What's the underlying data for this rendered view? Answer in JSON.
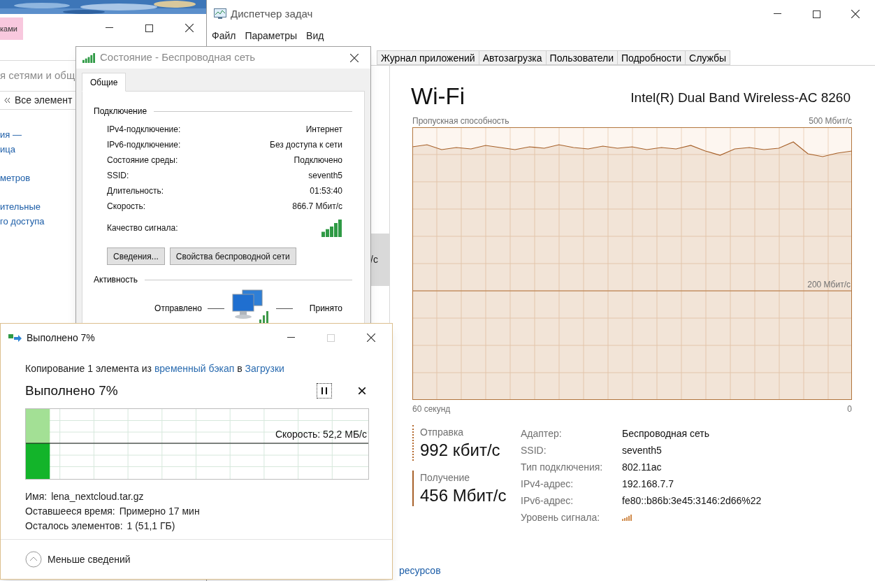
{
  "control_panel": {
    "tab_label": "ками",
    "address_fragment": "я сетями и общ",
    "breadcrumb": "Все элемент",
    "links": [
      {
        "lines": [
          "ия —",
          "ица"
        ]
      },
      {
        "lines": [
          "метров"
        ]
      },
      {
        "lines": [
          "ительные",
          "го доступа"
        ]
      }
    ]
  },
  "task_manager": {
    "title": "Диспетчер задач",
    "menu": [
      "Файл",
      "Параметры",
      "Вид"
    ],
    "tabs": [
      {
        "label": "Журнал приложений",
        "selected": false
      },
      {
        "label": "Автозагрузка",
        "selected": false
      },
      {
        "label": "Пользователи",
        "selected": false
      },
      {
        "label": "Подробности",
        "selected": false
      },
      {
        "label": "Службы",
        "selected": false
      }
    ],
    "sidebar_fragment": "/с",
    "device_title": "Wi-Fi",
    "adapter_name": "Intel(R) Dual Band Wireless-AC 8260",
    "graph": {
      "title": "Пропускная способность",
      "top_label": "500 Мбит/с",
      "mid_label": "200 Мбит/с",
      "left_label": "60 секунд",
      "right_label": "0"
    },
    "send": {
      "label": "Отправка",
      "value": "992 кбит/с"
    },
    "receive": {
      "label": "Получение",
      "value": "456 Мбит/с"
    },
    "details": [
      {
        "kind": "text",
        "label": "Адаптер:",
        "value": "Беспроводная сеть"
      },
      {
        "kind": "text",
        "label": "SSID:",
        "value": "seventh5"
      },
      {
        "kind": "text",
        "label": "Тип подключения:",
        "value": "802.11ac"
      },
      {
        "kind": "text",
        "label": "IPv4-адрес:",
        "value": "192.168.7.7"
      },
      {
        "kind": "text",
        "label": "IPv6-адрес:",
        "value": "fe80::b86b:3e45:3146:2d66%22"
      },
      {
        "kind": "signal",
        "label": "Уровень сигнала:"
      }
    ],
    "resource_link": "ресурсов"
  },
  "status_dialog": {
    "title": "Состояние - Беспроводная сеть",
    "tabs": [
      {
        "label": "Общие",
        "selected": true
      }
    ],
    "connection_header": "Подключение",
    "rows": [
      {
        "kind": "text",
        "label": "IPv4-подключение:",
        "value": "Интернет"
      },
      {
        "kind": "text",
        "label": "IPv6-подключение:",
        "value": "Без доступа к сети"
      },
      {
        "kind": "text",
        "label": "Состояние среды:",
        "value": "Подключено"
      },
      {
        "kind": "text",
        "label": "SSID:",
        "value": "seventh5"
      },
      {
        "kind": "text",
        "label": "Длительность:",
        "value": "01:53:40"
      },
      {
        "kind": "text",
        "label": "Скорость:",
        "value": "866.7 Мбит/с"
      },
      {
        "kind": "signal",
        "label": "Качество сигнала:"
      }
    ],
    "buttons": [
      "Сведения...",
      "Свойства беспроводной сети"
    ],
    "activity_header": "Активность",
    "sent": "Отправлено",
    "received": "Принято"
  },
  "copy_dialog": {
    "title": "Выполнено 7%",
    "window_buttons": [
      {
        "kind": "minimize",
        "disabled": false
      },
      {
        "kind": "maximize",
        "disabled": true
      },
      {
        "kind": "close",
        "disabled": false
      }
    ],
    "description": [
      {
        "kind": "text",
        "text": "Копирование 1 элемента из "
      },
      {
        "kind": "link",
        "text": "временный бэкап"
      },
      {
        "kind": "text",
        "text": " в "
      },
      {
        "kind": "link",
        "text": "Загрузки"
      }
    ],
    "heading": "Выполнено 7%",
    "progress": {
      "level": 0.07,
      "speed": "Скорость: 52,2 МБ/с"
    },
    "details": [
      {
        "label": "Имя:",
        "value": "lena_nextcloud.tar.gz"
      },
      {
        "label": "Оставшееся время:",
        "value": "Примерно 17 мин"
      },
      {
        "label": "Осталось элементов:",
        "value": "1 (51,1 ГБ)"
      }
    ],
    "toggle": "Меньше сведений"
  }
}
